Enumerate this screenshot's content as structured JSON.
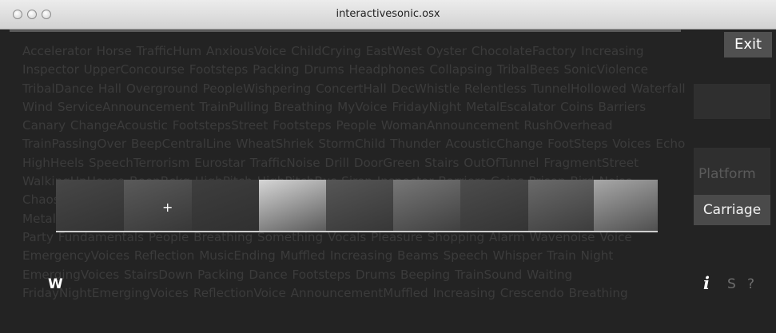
{
  "window": {
    "title": "interactivesonic.osx"
  },
  "colors": {
    "background": "#232323",
    "word_cloud_text": "#3b3b3b",
    "button": "#505050"
  },
  "word_cloud": {
    "text": "Accelerator Horse TrafficHum AnxiousVoice ChildCrying EastWest Oyster ChocolateFactory Increasing Inspector UpperConcourse Footsteps Packing Drums Headphones Collapsing TribalBees SonicViolence TribalDance Hall Overground PeopleWishpering ConcertHall DecWhistle Relentless TunnelHollowed Waterfall Wind ServiceAnnouncement TrainPulling Breathing MyVoice FridayNight MetalEscalator Coins Barriers Canary ChangeAcoustic FootstepsStreet Footsteps People WomanAnnouncement RushOverhead TrainPassingOver BeepCentralLine WheatShriek StormChild Thunder AcousticChange FootSteps Voices Echo HighHeels SpeechTerrorism Eurostar TrafficNoise Drill DoorGreen Stairs OutOfTunnel FragmentStreet WalkingUpHouse BeepBckg HighPitch HighPitchBus Siren Inspector Barriers Coins Prison Bird Noise ChaosEmergency Gates Slam GatesOpen OpeningAndClosing RushingSound Escalators TrainLeaving MetalObjects Customize StepTrainRaw RushingLiftDoor MetalEscalator SqueakingEscalator CarriageHall Party Fundamentals People Breathing Something Vocals Pleasure Shopping Alarm Wavenoise Voice EmergencyVoices Reflection MusicEnding Muffled Increasing Beams Speech Whisper Train Night EmergingVoices StairsDown Packing Dance Footsteps Drums Beeping TrainSound Waiting FridayNightEmergingVoices ReflectionVoice AnnouncementMuffled Increasing Crescendo Breathing WheatShriek StormChild Thunder AcousticChange FootSteps Voices Echo HighHeels SpeechTerrorism EurostarTrafficNoiseDrill DoorGreen Stairs OutOfTunnel FragmentStreet WalkingUpHouse BeepBackground"
  },
  "controls": {
    "exit_label": "Exit",
    "platform_label": "Platform",
    "carriage_label": "Carriage",
    "w_label": "W",
    "info_label": "i",
    "s_label": "S",
    "help_label": "?"
  },
  "timeline": {
    "cursor_label": "+",
    "frames": [
      {
        "name": "frame-dark-station",
        "color": "#474747"
      },
      {
        "name": "frame-dim-corridor",
        "color": "#5a5a5a"
      },
      {
        "name": "frame-dark-platform",
        "color": "#3e3e3e"
      },
      {
        "name": "frame-bright-light",
        "color": "#d6d6d6"
      },
      {
        "name": "frame-grey-wall",
        "color": "#565656"
      },
      {
        "name": "frame-grey-tiles",
        "color": "#777777"
      },
      {
        "name": "frame-escalator",
        "color": "#4c4c4c"
      },
      {
        "name": "frame-corridor-door",
        "color": "#6a6a6a"
      },
      {
        "name": "frame-pale-wall",
        "color": "#a8a8a8"
      }
    ]
  }
}
